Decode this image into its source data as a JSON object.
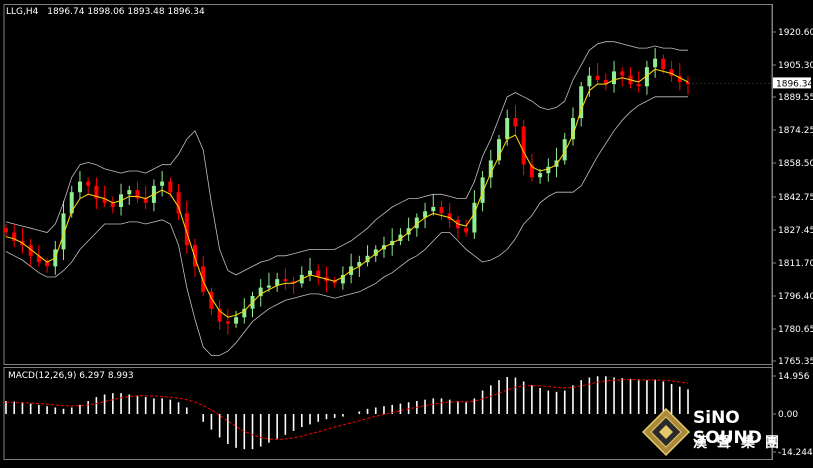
{
  "header": {
    "symbol": "LLG,H4",
    "ohlc": "1896.74 1898.06 1893.48 1896.34"
  },
  "macd_header": {
    "label": "MACD(12,26,9) 6.297 8.993"
  },
  "price_axis": {
    "ticks": [
      "1920.60",
      "1905.30",
      "1889.55",
      "1874.25",
      "1858.50",
      "1842.75",
      "1827.45",
      "1811.70",
      "1796.40",
      "1780.65",
      "1765.35"
    ],
    "current_price": "1896.34"
  },
  "macd_axis": {
    "ticks": [
      "14.956",
      "0.00",
      "-14.244"
    ]
  },
  "logo": {
    "brand": "SiNO SOUND",
    "chinese": "漢聲集團"
  },
  "colors": {
    "background": "#000000",
    "bull_candle": "#90EE90",
    "bear_candle": "#FF0000",
    "ma": "#FFD700",
    "bands": "#C0C0C0",
    "macd_hist": "#FFFFFF",
    "macd_signal": "#FF0000",
    "axis_text": "#FFFFFF"
  },
  "chart_data": {
    "type": "candlestick",
    "timeframe": "H4",
    "ylim": [
      1765.35,
      1925
    ],
    "price_series": [
      1826,
      1822,
      1820,
      1815,
      1812,
      1810,
      1818,
      1835,
      1845,
      1850,
      1848,
      1842,
      1840,
      1838,
      1844,
      1846,
      1842,
      1840,
      1848,
      1850,
      1845,
      1835,
      1820,
      1810,
      1798,
      1790,
      1784,
      1783,
      1786,
      1790,
      1796,
      1800,
      1801,
      1804,
      1803,
      1802,
      1806,
      1808,
      1805,
      1803,
      1802,
      1806,
      1810,
      1812,
      1815,
      1818,
      1820,
      1822,
      1825,
      1828,
      1833,
      1836,
      1838,
      1835,
      1832,
      1828,
      1826,
      1840,
      1852,
      1860,
      1870,
      1880,
      1876,
      1858,
      1852,
      1854,
      1857,
      1860,
      1870,
      1880,
      1895,
      1900,
      1898,
      1896,
      1902,
      1900,
      1896,
      1895,
      1904,
      1908,
      1903,
      1900,
      1897,
      1896
    ],
    "ma_series": [
      1824,
      1823,
      1821,
      1818,
      1815,
      1812,
      1814,
      1825,
      1836,
      1842,
      1844,
      1843,
      1842,
      1840,
      1841,
      1843,
      1843,
      1842,
      1844,
      1846,
      1844,
      1838,
      1826,
      1814,
      1803,
      1795,
      1789,
      1786,
      1787,
      1789,
      1793,
      1797,
      1799,
      1801,
      1802,
      1802,
      1804,
      1806,
      1805,
      1804,
      1803,
      1805,
      1808,
      1810,
      1813,
      1816,
      1819,
      1821,
      1823,
      1826,
      1830,
      1833,
      1835,
      1834,
      1833,
      1830,
      1829,
      1835,
      1845,
      1854,
      1862,
      1870,
      1872,
      1864,
      1857,
      1855,
      1856,
      1858,
      1864,
      1872,
      1884,
      1893,
      1896,
      1896,
      1898,
      1899,
      1898,
      1897,
      1900,
      1903,
      1902,
      1901,
      1899,
      1897
    ],
    "upper_band": [
      1831,
      1830,
      1829,
      1828,
      1827,
      1826,
      1830,
      1840,
      1852,
      1858,
      1859,
      1858,
      1856,
      1855,
      1854,
      1855,
      1855,
      1854,
      1856,
      1858,
      1858,
      1863,
      1870,
      1874,
      1865,
      1840,
      1818,
      1808,
      1806,
      1808,
      1810,
      1812,
      1813,
      1815,
      1815,
      1816,
      1817,
      1818,
      1818,
      1818,
      1818,
      1820,
      1822,
      1825,
      1828,
      1832,
      1835,
      1838,
      1840,
      1842,
      1842,
      1843,
      1844,
      1844,
      1843,
      1842,
      1842,
      1850,
      1862,
      1870,
      1880,
      1890,
      1892,
      1890,
      1888,
      1885,
      1884,
      1885,
      1888,
      1898,
      1905,
      1912,
      1915,
      1916,
      1916,
      1915,
      1914,
      1913,
      1913,
      1914,
      1913,
      1913,
      1912,
      1912
    ],
    "lower_band": [
      1817,
      1815,
      1813,
      1810,
      1807,
      1805,
      1805,
      1808,
      1812,
      1818,
      1822,
      1826,
      1830,
      1830,
      1830,
      1831,
      1831,
      1830,
      1831,
      1832,
      1830,
      1820,
      1800,
      1785,
      1772,
      1768,
      1768,
      1770,
      1774,
      1779,
      1784,
      1787,
      1790,
      1792,
      1794,
      1795,
      1796,
      1797,
      1797,
      1796,
      1795,
      1796,
      1797,
      1798,
      1800,
      1802,
      1805,
      1807,
      1810,
      1813,
      1815,
      1818,
      1822,
      1826,
      1826,
      1822,
      1818,
      1815,
      1812,
      1813,
      1815,
      1818,
      1823,
      1830,
      1834,
      1840,
      1843,
      1845,
      1845,
      1845,
      1848,
      1855,
      1862,
      1868,
      1874,
      1879,
      1883,
      1886,
      1888,
      1890,
      1890,
      1890,
      1890,
      1890
    ],
    "macd": {
      "ylim": [
        -14.244,
        14.956
      ],
      "values": [
        5,
        4.8,
        4.5,
        4,
        3.5,
        3,
        2.5,
        2,
        2.5,
        3.5,
        5,
        6.5,
        7.5,
        8,
        8,
        7.5,
        7,
        6.5,
        6,
        6,
        5.5,
        4.5,
        2.5,
        0,
        -3,
        -6,
        -9,
        -11.5,
        -13,
        -13.5,
        -13.5,
        -12.5,
        -11,
        -9.5,
        -8,
        -6.5,
        -5,
        -4,
        -3,
        -2,
        -1.5,
        -1,
        0,
        1,
        2,
        2.5,
        3,
        3.5,
        4,
        4.5,
        5,
        5.5,
        6,
        6,
        5.5,
        5,
        4.5,
        6,
        9,
        11,
        13,
        14.2,
        14,
        12.5,
        11,
        10,
        9,
        8.5,
        9,
        11,
        13,
        14,
        14.5,
        14.5,
        14,
        13.8,
        13.5,
        13,
        13,
        13.2,
        12.5,
        11.5,
        10.5,
        9.5
      ],
      "signal": [
        4.5,
        4.4,
        4.3,
        4.2,
        4,
        3.8,
        3.5,
        3.2,
        3.1,
        3.2,
        3.5,
        4,
        4.8,
        5.5,
        6.2,
        6.7,
        7,
        7,
        6.9,
        6.7,
        6.5,
        6.1,
        5.5,
        4.6,
        3.3,
        1.6,
        -0.5,
        -2.7,
        -4.8,
        -6.7,
        -8,
        -9,
        -9.6,
        -9.8,
        -9.6,
        -9.2,
        -8.5,
        -7.7,
        -6.8,
        -5.9,
        -5,
        -4.2,
        -3.4,
        -2.6,
        -1.7,
        -0.9,
        -0.1,
        0.6,
        1.3,
        2,
        2.6,
        3.2,
        3.8,
        4.3,
        4.6,
        4.7,
        4.7,
        5,
        5.8,
        6.8,
        8,
        9.2,
        10.3,
        10.8,
        10.9,
        10.8,
        10.6,
        10.2,
        10,
        10.2,
        10.8,
        11.5,
        12.2,
        12.7,
        13,
        13.1,
        13.2,
        13.2,
        13.1,
        13.1,
        13,
        12.7,
        12.3,
        11.8
      ]
    }
  }
}
